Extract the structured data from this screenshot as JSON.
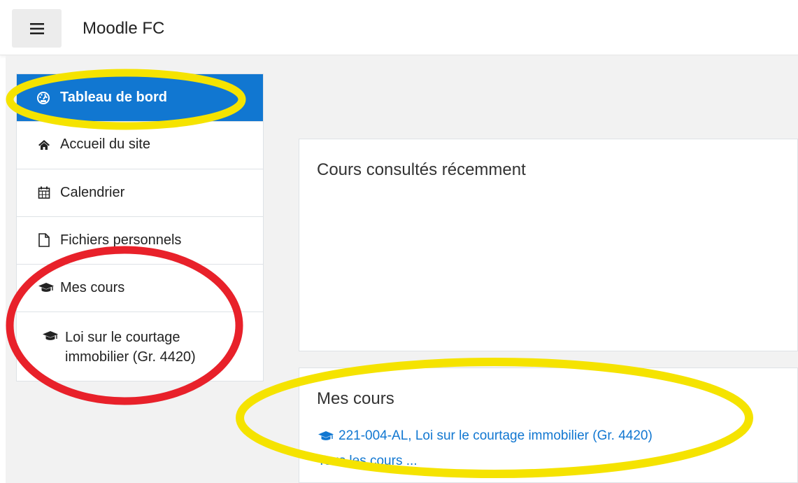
{
  "header": {
    "site_name": "Moodle FC",
    "menu_icon": "hamburger-menu-icon"
  },
  "sidebar": {
    "items": [
      {
        "label": "Tableau de bord",
        "icon": "dashboard-icon",
        "active": true
      },
      {
        "label": "Accueil du site",
        "icon": "home-icon"
      },
      {
        "label": "Calendrier",
        "icon": "calendar-icon"
      },
      {
        "label": "Fichiers personnels",
        "icon": "file-icon"
      },
      {
        "label": "Mes cours",
        "icon": "graduation-cap-icon"
      },
      {
        "label": "Loi sur le courtage immobilier (Gr. 4420)",
        "label_line1": "Loi sur le courtage",
        "label_line2": "immobilier (Gr. 4420)",
        "icon": "graduation-cap-icon"
      }
    ]
  },
  "main": {
    "recent_courses": {
      "title": "Cours consultés récemment"
    },
    "my_courses": {
      "title": "Mes cours",
      "courses": [
        {
          "label": "221-004-AL, Loi sur le courtage immobilier (Gr. 4420)",
          "icon": "graduation-cap-icon"
        }
      ],
      "all_courses_link": "Tous les cours ..."
    }
  },
  "annotations": [
    {
      "shape": "ellipse",
      "color": "#f5e300",
      "target": "Tableau de bord"
    },
    {
      "shape": "ellipse",
      "color": "#e8212a",
      "target": "Mes cours"
    },
    {
      "shape": "ellipse",
      "color": "#f5e300",
      "target": "Mes cours"
    }
  ],
  "colors": {
    "accent": "#1177d1",
    "highlight_yellow": "#f5e300",
    "highlight_red": "#e8212a"
  }
}
